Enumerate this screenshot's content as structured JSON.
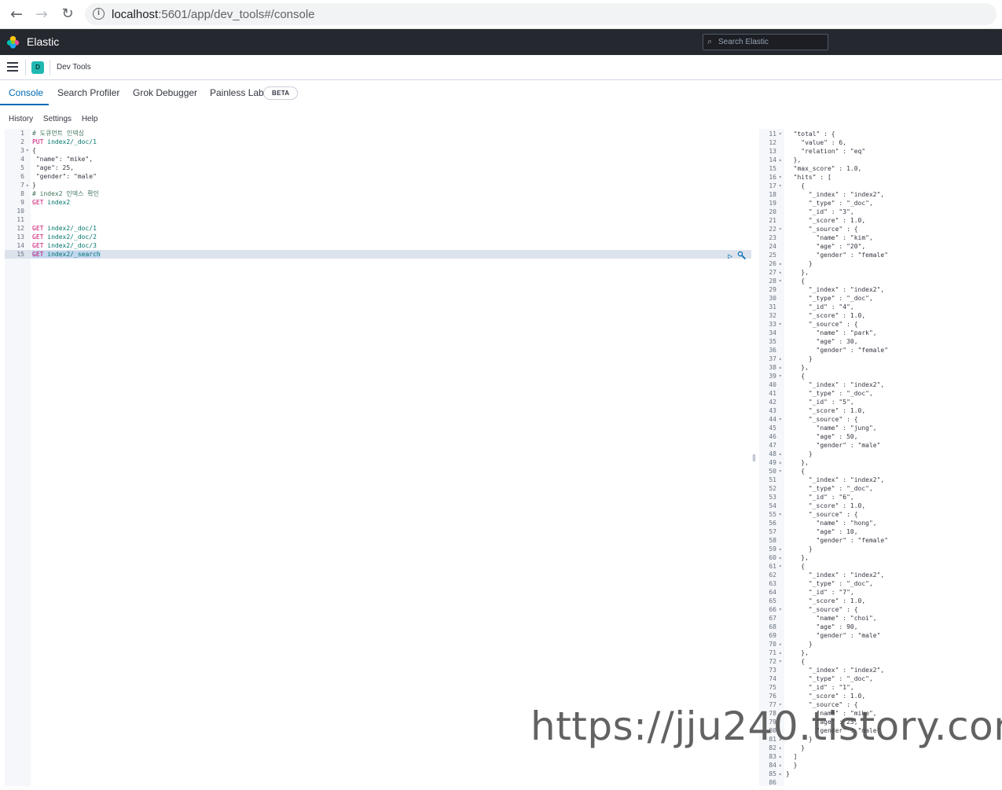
{
  "browser": {
    "url_host": "localhost",
    "url_path": ":5601/app/dev_tools#/console",
    "back_icon": "arrow-left",
    "forward_icon": "arrow-right",
    "reload_icon": "reload",
    "info_icon": "info-circle"
  },
  "header": {
    "brand": "Elastic",
    "search_placeholder": "Search Elastic"
  },
  "breadcrumb": {
    "space_initial": "D",
    "title": "Dev Tools"
  },
  "tabs": [
    {
      "label": "Console",
      "active": true
    },
    {
      "label": "Search Profiler",
      "active": false
    },
    {
      "label": "Grok Debugger",
      "active": false
    },
    {
      "label": "Painless Lab",
      "active": false
    }
  ],
  "beta_label": "BETA",
  "menu": {
    "history": "History",
    "settings": "Settings",
    "help": "Help"
  },
  "request_lines": [
    {
      "n": "1",
      "fold": "",
      "parts": [
        [
          "c-comment",
          "# 도큐먼트 인덱싱"
        ]
      ]
    },
    {
      "n": "2",
      "fold": "",
      "parts": [
        [
          "c-method",
          "PUT"
        ],
        [
          "",
          " "
        ],
        [
          "c-url",
          "index2/_doc/1"
        ]
      ]
    },
    {
      "n": "3",
      "fold": "▾",
      "parts": [
        [
          "c-str",
          "{"
        ]
      ]
    },
    {
      "n": "4",
      "fold": "",
      "parts": [
        [
          "c-key",
          " \"name\": \"mike\","
        ]
      ]
    },
    {
      "n": "5",
      "fold": "",
      "parts": [
        [
          "c-key",
          " \"age\": 25,"
        ]
      ]
    },
    {
      "n": "6",
      "fold": "",
      "parts": [
        [
          "c-key",
          " \"gender\": \"male\""
        ]
      ]
    },
    {
      "n": "7",
      "fold": "▴",
      "parts": [
        [
          "c-str",
          "}"
        ]
      ]
    },
    {
      "n": "8",
      "fold": "",
      "parts": [
        [
          "c-comment",
          "# index2 인덱스 확인"
        ]
      ]
    },
    {
      "n": "9",
      "fold": "",
      "parts": [
        [
          "c-method",
          "GET"
        ],
        [
          "",
          " "
        ],
        [
          "c-url",
          "index2"
        ]
      ]
    },
    {
      "n": "10",
      "fold": "",
      "parts": []
    },
    {
      "n": "11",
      "fold": "",
      "parts": []
    },
    {
      "n": "12",
      "fold": "",
      "parts": [
        [
          "c-method",
          "GET"
        ],
        [
          "",
          " "
        ],
        [
          "c-url",
          "index2/_doc/1"
        ]
      ]
    },
    {
      "n": "13",
      "fold": "",
      "parts": [
        [
          "c-method",
          "GET"
        ],
        [
          "",
          " "
        ],
        [
          "c-url",
          "index2/_doc/2"
        ]
      ]
    },
    {
      "n": "14",
      "fold": "",
      "parts": [
        [
          "c-method",
          "GET"
        ],
        [
          "",
          " "
        ],
        [
          "c-url",
          "index2/_doc/3"
        ]
      ]
    },
    {
      "n": "15",
      "fold": "",
      "selected": true,
      "parts": [
        [
          "c-method sel",
          "GET"
        ],
        [
          "sel",
          " "
        ],
        [
          "c-url sel",
          "index2/_search"
        ]
      ]
    }
  ],
  "response_lines": [
    [
      "11",
      "▾",
      "  \"total\" : {"
    ],
    [
      "12",
      "",
      "    \"value\" : 6,"
    ],
    [
      "13",
      "",
      "    \"relation\" : \"eq\""
    ],
    [
      "14",
      "▴",
      "  },"
    ],
    [
      "15",
      "",
      "  \"max_score\" : 1.0,"
    ],
    [
      "16",
      "▾",
      "  \"hits\" : ["
    ],
    [
      "17",
      "▾",
      "    {"
    ],
    [
      "18",
      "",
      "      \"_index\" : \"index2\","
    ],
    [
      "19",
      "",
      "      \"_type\" : \"_doc\","
    ],
    [
      "20",
      "",
      "      \"_id\" : \"3\","
    ],
    [
      "21",
      "",
      "      \"_score\" : 1.0,"
    ],
    [
      "22",
      "▾",
      "      \"_source\" : {"
    ],
    [
      "23",
      "",
      "        \"name\" : \"kim\","
    ],
    [
      "24",
      "",
      "        \"age\" : \"20\","
    ],
    [
      "25",
      "",
      "        \"gender\" : \"female\""
    ],
    [
      "26",
      "▴",
      "      }"
    ],
    [
      "27",
      "▴",
      "    },"
    ],
    [
      "28",
      "▾",
      "    {"
    ],
    [
      "29",
      "",
      "      \"_index\" : \"index2\","
    ],
    [
      "30",
      "",
      "      \"_type\" : \"_doc\","
    ],
    [
      "31",
      "",
      "      \"_id\" : \"4\","
    ],
    [
      "32",
      "",
      "      \"_score\" : 1.0,"
    ],
    [
      "33",
      "▾",
      "      \"_source\" : {"
    ],
    [
      "34",
      "",
      "        \"name\" : \"park\","
    ],
    [
      "35",
      "",
      "        \"age\" : 30,"
    ],
    [
      "36",
      "",
      "        \"gender\" : \"female\""
    ],
    [
      "37",
      "▴",
      "      }"
    ],
    [
      "38",
      "▴",
      "    },"
    ],
    [
      "39",
      "▾",
      "    {"
    ],
    [
      "40",
      "",
      "      \"_index\" : \"index2\","
    ],
    [
      "41",
      "",
      "      \"_type\" : \"_doc\","
    ],
    [
      "42",
      "",
      "      \"_id\" : \"5\","
    ],
    [
      "43",
      "",
      "      \"_score\" : 1.0,"
    ],
    [
      "44",
      "▾",
      "      \"_source\" : {"
    ],
    [
      "45",
      "",
      "        \"name\" : \"jung\","
    ],
    [
      "46",
      "",
      "        \"age\" : 50,"
    ],
    [
      "47",
      "",
      "        \"gender\" : \"male\""
    ],
    [
      "48",
      "▴",
      "      }"
    ],
    [
      "49",
      "▴",
      "    },"
    ],
    [
      "50",
      "▾",
      "    {"
    ],
    [
      "51",
      "",
      "      \"_index\" : \"index2\","
    ],
    [
      "52",
      "",
      "      \"_type\" : \"_doc\","
    ],
    [
      "53",
      "",
      "      \"_id\" : \"6\","
    ],
    [
      "54",
      "",
      "      \"_score\" : 1.0,"
    ],
    [
      "55",
      "▾",
      "      \"_source\" : {"
    ],
    [
      "56",
      "",
      "        \"name\" : \"hong\","
    ],
    [
      "57",
      "",
      "        \"age\" : 10,"
    ],
    [
      "58",
      "",
      "        \"gender\" : \"female\""
    ],
    [
      "59",
      "▴",
      "      }"
    ],
    [
      "60",
      "▴",
      "    },"
    ],
    [
      "61",
      "▾",
      "    {"
    ],
    [
      "62",
      "",
      "      \"_index\" : \"index2\","
    ],
    [
      "63",
      "",
      "      \"_type\" : \"_doc\","
    ],
    [
      "64",
      "",
      "      \"_id\" : \"7\","
    ],
    [
      "65",
      "",
      "      \"_score\" : 1.0,"
    ],
    [
      "66",
      "▾",
      "      \"_source\" : {"
    ],
    [
      "67",
      "",
      "        \"name\" : \"choi\","
    ],
    [
      "68",
      "",
      "        \"age\" : 90,"
    ],
    [
      "69",
      "",
      "        \"gender\" : \"male\""
    ],
    [
      "70",
      "▴",
      "      }"
    ],
    [
      "71",
      "▴",
      "    },"
    ],
    [
      "72",
      "▾",
      "    {"
    ],
    [
      "73",
      "",
      "      \"_index\" : \"index2\","
    ],
    [
      "74",
      "",
      "      \"_type\" : \"_doc\","
    ],
    [
      "75",
      "",
      "      \"_id\" : \"1\","
    ],
    [
      "76",
      "",
      "      \"_score\" : 1.0,"
    ],
    [
      "77",
      "▾",
      "      \"_source\" : {"
    ],
    [
      "78",
      "",
      "        \"name\" : \"mike\","
    ],
    [
      "79",
      "",
      "        \"age\" : 25,"
    ],
    [
      "80",
      "",
      "        \"gender\" : \"male\""
    ],
    [
      "81",
      "▴",
      "      }"
    ],
    [
      "82",
      "▴",
      "    }"
    ],
    [
      "83",
      "▴",
      "  ]"
    ],
    [
      "84",
      "▴",
      "  }"
    ],
    [
      "85",
      "▴",
      "}"
    ],
    [
      "86",
      "",
      ""
    ]
  ],
  "actions": {
    "run_icon": "play-icon",
    "wrench_icon": "wrench-icon"
  },
  "watermark": "https://jju240.tistory.com"
}
